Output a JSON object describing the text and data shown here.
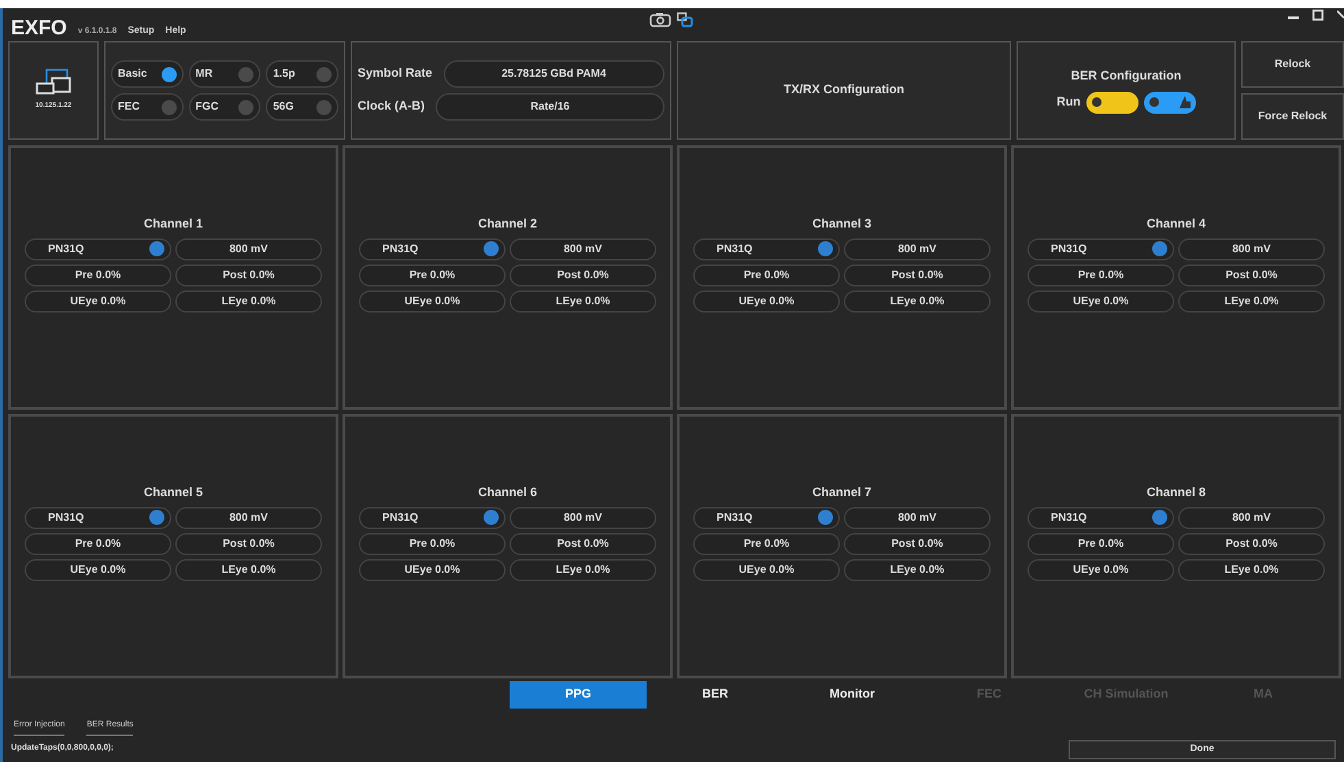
{
  "app": {
    "logo": "EXFO",
    "version": "v 6.1.0.1.8",
    "menu": [
      "Setup",
      "Help"
    ]
  },
  "device": {
    "address": "10.125.1.22"
  },
  "modes": [
    {
      "label": "Basic",
      "on": true
    },
    {
      "label": "MR",
      "on": false
    },
    {
      "label": "1.5p",
      "on": false
    },
    {
      "label": "FEC",
      "on": false
    },
    {
      "label": "FGC",
      "on": false
    },
    {
      "label": "56G",
      "on": false
    }
  ],
  "signal": [
    {
      "label": "Symbol Rate",
      "value": "25.78125 GBd PAM4"
    },
    {
      "label": "Clock (A-B)",
      "value": "Rate/16"
    }
  ],
  "txrx_button": "TX/RX Configuration",
  "ber_config": {
    "title": "BER Configuration",
    "run_label": "Run",
    "run_on": true,
    "clear_on": true
  },
  "relock_buttons": [
    "Relock",
    "Force Relock"
  ],
  "channels": [
    {
      "title": "Channel 1",
      "pattern": "PN31Q",
      "on": true,
      "amplitude": "800 mV",
      "pre": "Pre 0.0%",
      "post": "Post 0.0%",
      "ueye": "UEye 0.0%",
      "leye": "LEye 0.0%"
    },
    {
      "title": "Channel 2",
      "pattern": "PN31Q",
      "on": true,
      "amplitude": "800 mV",
      "pre": "Pre 0.0%",
      "post": "Post 0.0%",
      "ueye": "UEye 0.0%",
      "leye": "LEye 0.0%"
    },
    {
      "title": "Channel 3",
      "pattern": "PN31Q",
      "on": true,
      "amplitude": "800 mV",
      "pre": "Pre 0.0%",
      "post": "Post 0.0%",
      "ueye": "UEye 0.0%",
      "leye": "LEye 0.0%"
    },
    {
      "title": "Channel 4",
      "pattern": "PN31Q",
      "on": true,
      "amplitude": "800 mV",
      "pre": "Pre 0.0%",
      "post": "Post 0.0%",
      "ueye": "UEye 0.0%",
      "leye": "LEye 0.0%"
    },
    {
      "title": "Channel 5",
      "pattern": "PN31Q",
      "on": true,
      "amplitude": "800 mV",
      "pre": "Pre 0.0%",
      "post": "Post 0.0%",
      "ueye": "UEye 0.0%",
      "leye": "LEye 0.0%"
    },
    {
      "title": "Channel 6",
      "pattern": "PN31Q",
      "on": true,
      "amplitude": "800 mV",
      "pre": "Pre 0.0%",
      "post": "Post 0.0%",
      "ueye": "UEye 0.0%",
      "leye": "LEye 0.0%"
    },
    {
      "title": "Channel 7",
      "pattern": "PN31Q",
      "on": true,
      "amplitude": "800 mV",
      "pre": "Pre 0.0%",
      "post": "Post 0.0%",
      "ueye": "UEye 0.0%",
      "leye": "LEye 0.0%"
    },
    {
      "title": "Channel 8",
      "pattern": "PN31Q",
      "on": true,
      "amplitude": "800 mV",
      "pre": "Pre 0.0%",
      "post": "Post 0.0%",
      "ueye": "UEye 0.0%",
      "leye": "LEye 0.0%"
    }
  ],
  "tabs": [
    {
      "label": "PPG",
      "selected": true,
      "disabled": false
    },
    {
      "label": "BER",
      "selected": false,
      "disabled": false
    },
    {
      "label": "Monitor",
      "selected": false,
      "disabled": false
    },
    {
      "label": "FEC",
      "selected": false,
      "disabled": true
    },
    {
      "label": "CH Simulation",
      "selected": false,
      "disabled": true
    },
    {
      "label": "MA",
      "selected": false,
      "disabled": true
    }
  ],
  "subtabs": [
    {
      "label": "Error Injection",
      "selected": false
    },
    {
      "label": "BER Results",
      "selected": false
    }
  ],
  "status_bar": {
    "message": "UpdateTaps(0,0,800,0,0,0);",
    "done_button": "Done"
  }
}
